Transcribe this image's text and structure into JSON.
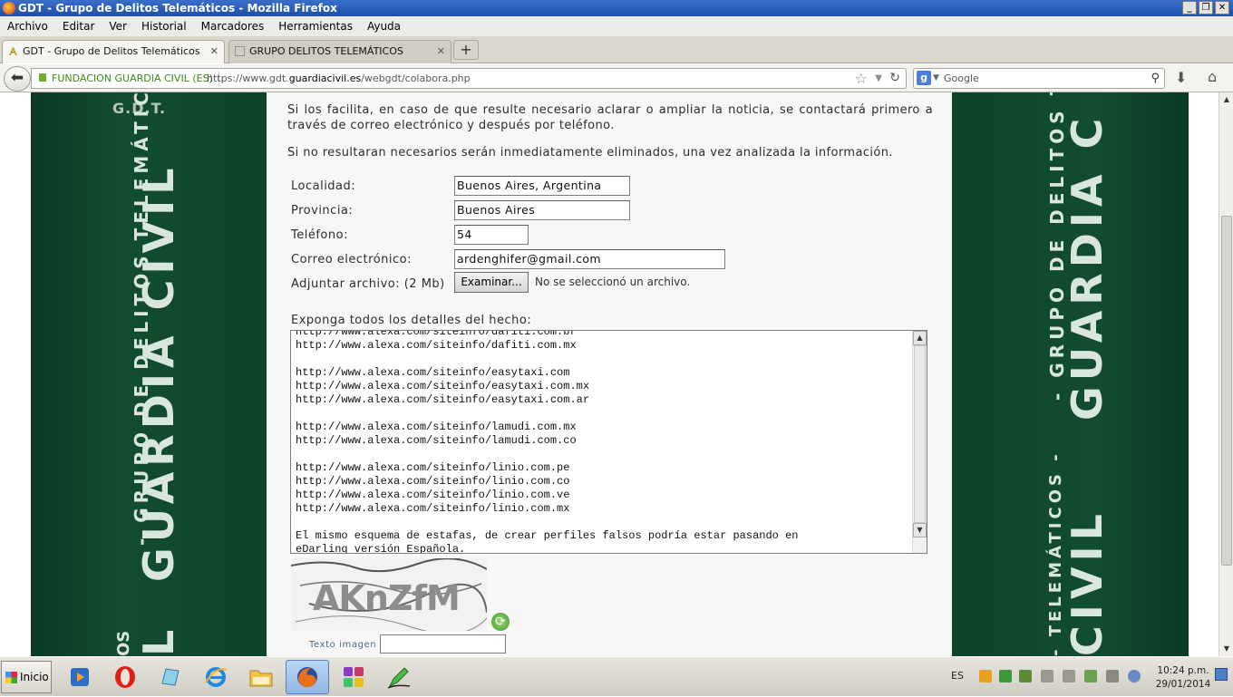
{
  "window": {
    "title": "GDT - Grupo de Delitos Telemáticos - Mozilla Firefox"
  },
  "menu": [
    "Archivo",
    "Editar",
    "Ver",
    "Historial",
    "Marcadores",
    "Herramientas",
    "Ayuda"
  ],
  "tabs": [
    {
      "label": "GDT - Grupo de Delitos Telemáticos",
      "active": true
    },
    {
      "label": "GRUPO DELITOS TELEMÁTICOS",
      "active": false
    }
  ],
  "nav": {
    "site_identity": "FUNDACION GUARDIA CIVIL (ES)",
    "url_prefix": "https://www.gdt.",
    "url_domain": "guardiacivil.es",
    "url_path": "/webgdt/colabora.php",
    "search_placeholder": "Google"
  },
  "banner": {
    "logo_text": "G.D.T.",
    "left_line1": "- GRUPO DE DELITOS TELEMÁTICOS -",
    "left_line2": "GUARDIA CIVIL",
    "left_line3": "L",
    "left_line4": "OS",
    "right_line1": "- GRUPO DE DELITOS TELE",
    "right_line2": "GUARDIA C",
    "right_line3": "- TELEMÁTICOS -",
    "right_line4": "CIVIL"
  },
  "form": {
    "intro_1": "Si los facilita, en caso de que resulte necesario aclarar o ampliar la noticia, se contactará primero a través de correo electrónico y después por teléfono.",
    "intro_2": "Si no resultaran necesarios serán inmediatamente eliminados, una vez analizada la información.",
    "locality_label": "Localidad:",
    "locality_value": "Buenos Aires, Argentina",
    "province_label": "Provincia:",
    "province_value": "Buenos Aires",
    "phone_label": "Teléfono:",
    "phone_value": "54",
    "email_label": "Correo electrónico:",
    "email_value": "ardenghifer@gmail.com",
    "attach_label": "Adjuntar archivo: (2 Mb)",
    "browse_button": "Examinar...",
    "no_file": "No se seleccionó un archivo.",
    "details_label": "Exponga todos los detalles del hecho:",
    "details_text": "http://www.alexa.com/siteinfo/dafiti.com.br\nhttp://www.alexa.com/siteinfo/dafiti.com.mx\n\nhttp://www.alexa.com/siteinfo/easytaxi.com\nhttp://www.alexa.com/siteinfo/easytaxi.com.mx\nhttp://www.alexa.com/siteinfo/easytaxi.com.ar\n\nhttp://www.alexa.com/siteinfo/lamudi.com.mx\nhttp://www.alexa.com/siteinfo/lamudi.com.co\n\nhttp://www.alexa.com/siteinfo/linio.com.pe\nhttp://www.alexa.com/siteinfo/linio.com.co\nhttp://www.alexa.com/siteinfo/linio.com.ve\nhttp://www.alexa.com/siteinfo/linio.com.mx\n\nEl mismo esquema de estafas, de crear perfiles falsos podría estar pasando en\neDarling versión Española.",
    "captcha_text": "AKnZfM",
    "captcha_label": "Texto imagen"
  },
  "taskbar": {
    "start_label": "Inicio",
    "apps": [
      "media-player-icon",
      "opera-icon",
      "notepad-icon",
      "internet-explorer-icon",
      "folder-icon",
      "firefox-icon",
      "app-grid-icon",
      "pen-icon"
    ],
    "language": "ES",
    "time": "10:24 p.m.",
    "date": "29/01/2014"
  }
}
